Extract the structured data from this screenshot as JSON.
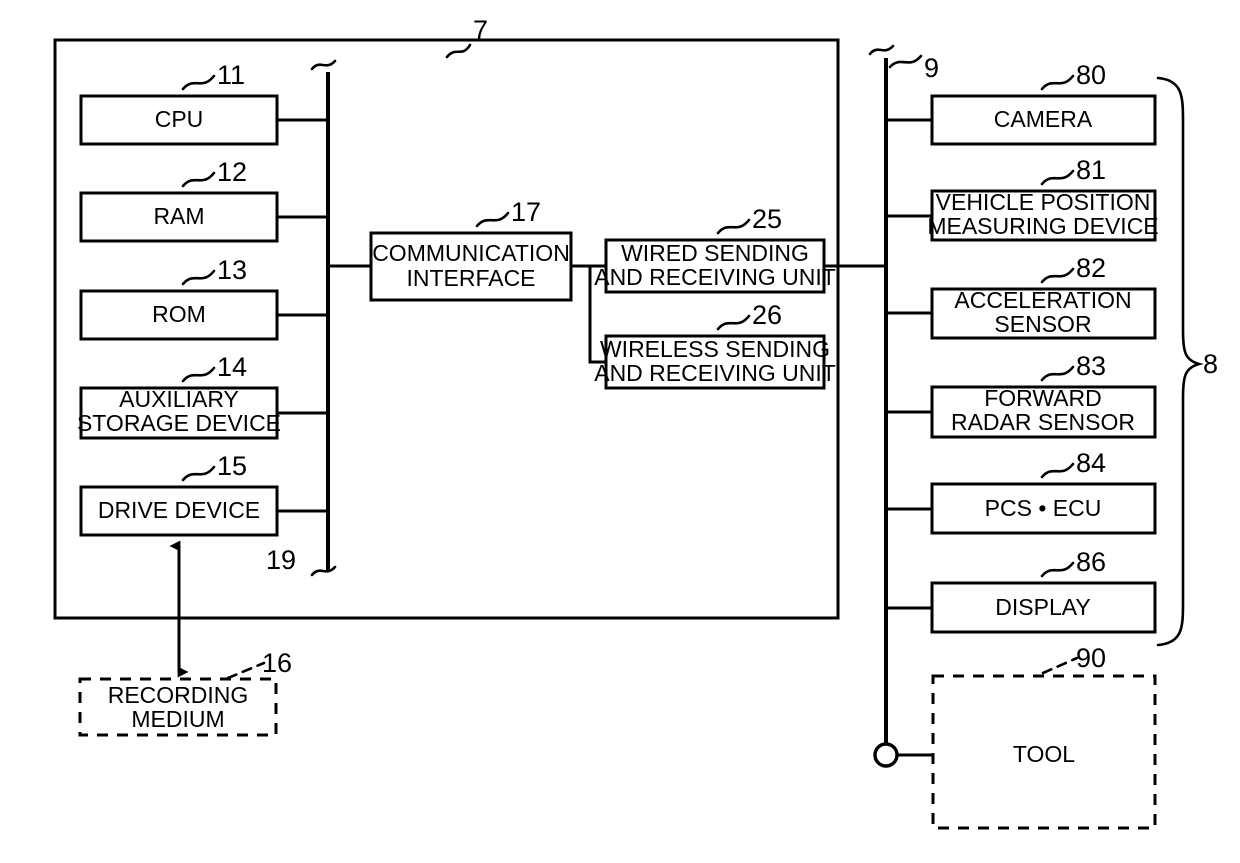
{
  "figure": {
    "type": "patent-block-diagram",
    "background_color": "#ffffff",
    "line_color": "#000000"
  },
  "reference_numerals": {
    "system_unit": "7",
    "peripheral_bus": "9",
    "internal_bus": "19",
    "peripheral_group": "8",
    "cpu": "11",
    "ram": "12",
    "rom": "13",
    "auxiliary_storage_device": "14",
    "drive_device": "15",
    "recording_medium": "16",
    "communication_interface": "17",
    "wired_unit": "25",
    "wireless_unit": "26",
    "camera": "80",
    "vehicle_position_measuring_device": "81",
    "acceleration_sensor": "82",
    "forward_radar_sensor": "83",
    "pcs_ecu": "84",
    "display": "86",
    "tool": "90"
  },
  "left_column": {
    "blocks": [
      {
        "id": "cpu",
        "label": "CPU",
        "numeral": "11"
      },
      {
        "id": "ram",
        "label": "RAM",
        "numeral": "12"
      },
      {
        "id": "rom",
        "label": "ROM",
        "numeral": "13"
      },
      {
        "id": "aux",
        "label_line1": "AUXILIARY",
        "label_line2": "STORAGE DEVICE",
        "numeral": "14"
      },
      {
        "id": "drive",
        "label": "DRIVE DEVICE",
        "numeral": "15"
      }
    ]
  },
  "center_column": {
    "communication_interface": {
      "label_line1": "COMMUNICATION",
      "label_line2": "INTERFACE",
      "numeral": "17"
    },
    "wired_unit": {
      "label_line1": "WIRED SENDING",
      "label_line2": "AND RECEIVING UNIT",
      "numeral": "25"
    },
    "wireless_unit": {
      "label_line1": "WIRELESS SENDING",
      "label_line2": "AND RECEIVING UNIT",
      "numeral": "26"
    }
  },
  "right_column": {
    "blocks": [
      {
        "id": "camera",
        "label": "CAMERA",
        "numeral": "80"
      },
      {
        "id": "vehicle_position",
        "label_line1": "VEHICLE POSITION",
        "label_line2": "MEASURING DEVICE",
        "numeral": "81"
      },
      {
        "id": "acceleration",
        "label_line1": "ACCELERATION",
        "label_line2": "SENSOR",
        "numeral": "82"
      },
      {
        "id": "forward_radar",
        "label_line1": "FORWARD",
        "label_line2": "RADAR SENSOR",
        "numeral": "83"
      },
      {
        "id": "pcs_ecu",
        "label": "PCS • ECU",
        "numeral": "84"
      },
      {
        "id": "display",
        "label": "DISPLAY",
        "numeral": "86"
      }
    ],
    "group_numeral": "8"
  },
  "external": {
    "recording_medium": {
      "label_line1": "RECORDING",
      "label_line2": "MEDIUM",
      "numeral": "16",
      "style": "dashed"
    },
    "tool": {
      "label": "TOOL",
      "numeral": "90",
      "style": "dashed"
    }
  }
}
